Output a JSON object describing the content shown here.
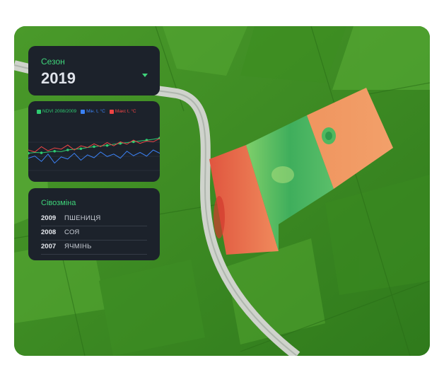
{
  "season": {
    "label": "Сезон",
    "year": "2019"
  },
  "chart": {
    "legend": [
      {
        "label": "NDVI 2008/2009",
        "color": "#2ecc71"
      },
      {
        "label": "Мін. t, °C",
        "color": "#3b82f6"
      },
      {
        "label": "Макс t, °C",
        "color": "#ef4444"
      }
    ]
  },
  "chart_data": {
    "type": "line",
    "series": [
      {
        "name": "NDVI 2008/2009",
        "values": [
          0.42,
          0.44,
          0.43,
          0.45,
          0.47,
          0.46,
          0.5,
          0.52,
          0.53,
          0.56,
          0.58,
          0.6,
          0.61,
          0.64,
          0.66,
          0.68,
          0.7,
          0.72,
          0.74,
          0.76,
          0.79
        ]
      },
      {
        "name": "Мін. t, °C",
        "values": [
          0.3,
          0.35,
          0.22,
          0.4,
          0.18,
          0.33,
          0.28,
          0.42,
          0.25,
          0.38,
          0.31,
          0.45,
          0.34,
          0.4,
          0.3,
          0.47,
          0.36,
          0.44,
          0.35,
          0.5,
          0.42
        ]
      },
      {
        "name": "Макс t, °C",
        "values": [
          0.5,
          0.45,
          0.58,
          0.48,
          0.55,
          0.52,
          0.62,
          0.5,
          0.6,
          0.56,
          0.65,
          0.58,
          0.68,
          0.6,
          0.7,
          0.64,
          0.74,
          0.66,
          0.72,
          0.7,
          0.78
        ]
      }
    ]
  },
  "rotation": {
    "title": "Сівозміна",
    "rows": [
      {
        "year": "2009",
        "crop": "ПШЕНИЦЯ"
      },
      {
        "year": "2008",
        "crop": "СОЯ"
      },
      {
        "year": "2007",
        "crop": "ЯЧМІНЬ"
      }
    ]
  }
}
